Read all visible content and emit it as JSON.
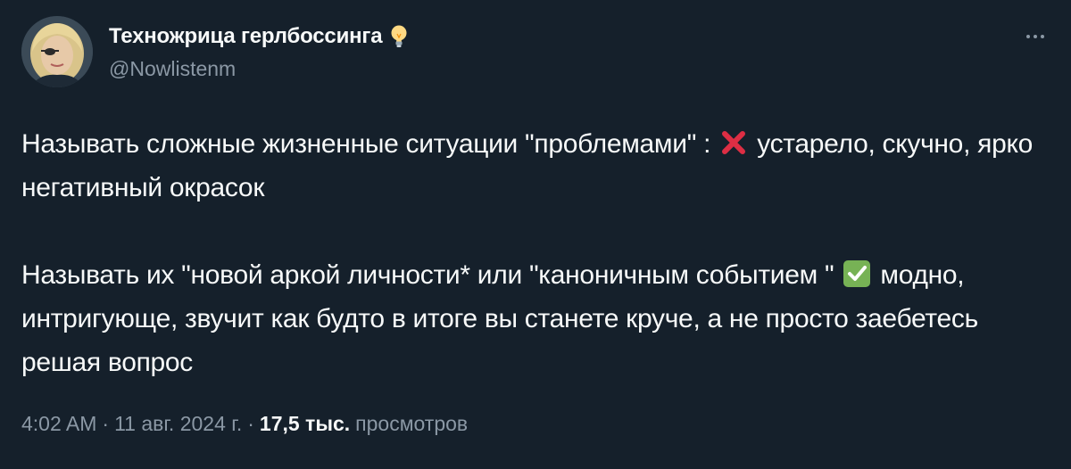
{
  "author": {
    "display_name": "Техножрица герлбоссинга",
    "badge_icon": "light-bulb-icon",
    "handle": "@Nowlistenm",
    "avatar_icon": "avatar-photo"
  },
  "header": {
    "more_icon": "more-horizontal-icon"
  },
  "tweet": {
    "p1_before": "Называть сложные жизненные ситуации \"проблемами\" : ",
    "p1_icon": "cross-mark-icon",
    "p1_after": " устарело, скучно, ярко негативный окрасок",
    "p2_before": "Называть их \"новой аркой личности* или \"каноничным событием \" ",
    "p2_icon": "check-mark-button-icon",
    "p2_after": " модно, интригующе, звучит как будто в итоге вы станете круче, а не просто заебетесь решая вопрос"
  },
  "meta": {
    "time": "4:02 AM",
    "separator": "·",
    "date": "11 авг. 2024 г.",
    "views_count": "17,5 тыс.",
    "views_label": "просмотров"
  },
  "colors": {
    "background": "#15202b",
    "text_primary": "#f7f9f9",
    "text_secondary": "#8b98a5",
    "cross_red": "#dd2e44",
    "check_green": "#77b255"
  }
}
